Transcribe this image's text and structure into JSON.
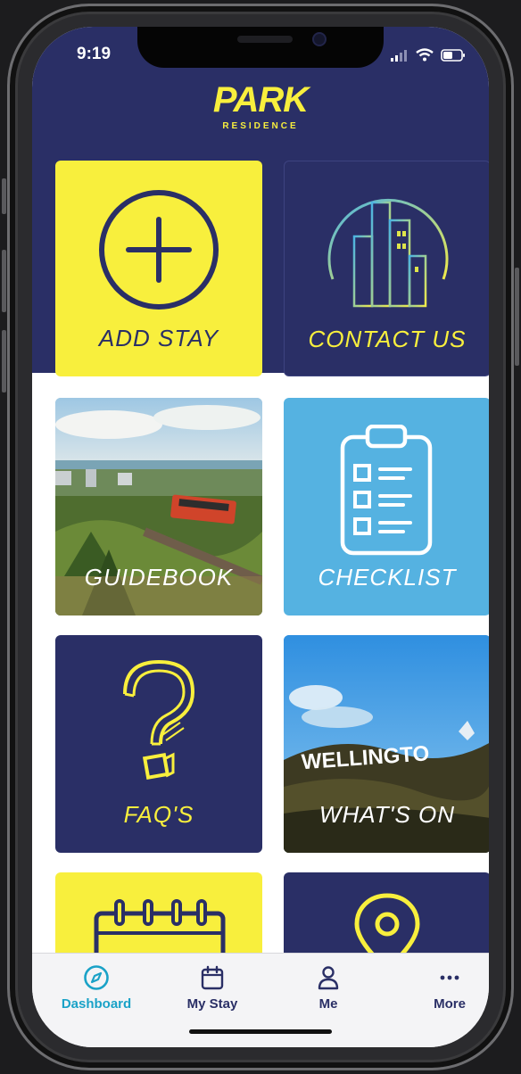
{
  "status": {
    "time": "9:19"
  },
  "brand": {
    "name": "PARK",
    "subtitle": "RESIDENCE"
  },
  "tiles": {
    "add_stay": "ADD STAY",
    "contact_us": "CONTACT US",
    "guidebook": "GUIDEBOOK",
    "checklist": "CHECKLIST",
    "faqs": "FAQ'S",
    "whats_on": "WHAT'S ON",
    "wellington_sign": "WELLINGTO"
  },
  "tabs": [
    {
      "label": "Dashboard",
      "icon": "compass-icon",
      "active": true
    },
    {
      "label": "My Stay",
      "icon": "calendar-icon",
      "active": false
    },
    {
      "label": "Me",
      "icon": "person-icon",
      "active": false
    },
    {
      "label": "More",
      "icon": "ellipsis-icon",
      "active": false
    }
  ],
  "colors": {
    "navy": "#2a2f66",
    "yellow": "#f8ef3d",
    "sky_blue": "#55b2e1",
    "tab_active": "#1aa2c7"
  }
}
